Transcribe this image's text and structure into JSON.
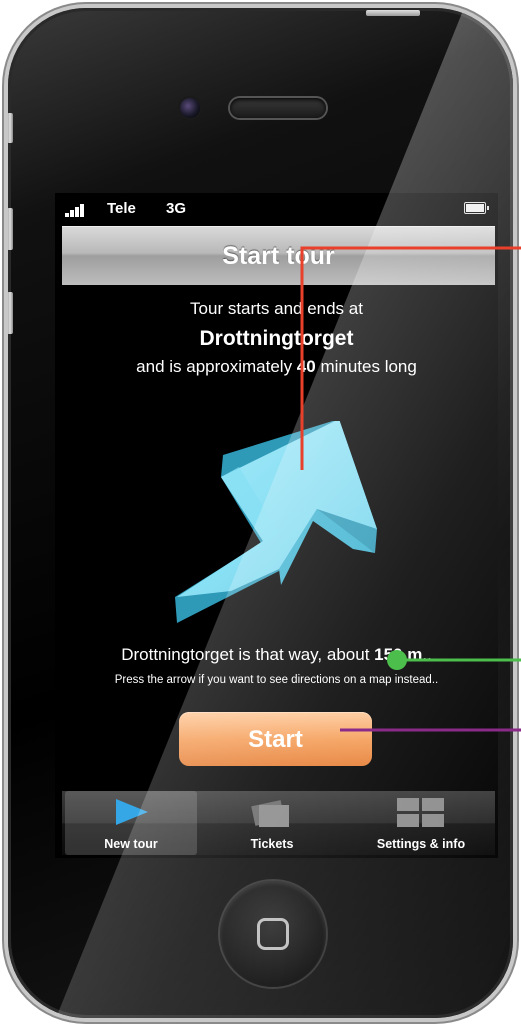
{
  "status_bar": {
    "carrier": "Tele",
    "network": "3G"
  },
  "nav": {
    "title": "Start tour"
  },
  "intro": {
    "line1": "Tour starts and ends at",
    "location": "Drottningtorget",
    "duration_prefix": "and is approximately ",
    "duration_value": "40",
    "duration_suffix": " minutes long"
  },
  "direction": {
    "prefix": "Drottningtorget is that way, about ",
    "distance": "150 m",
    "suffix": "..",
    "hint": "Press the arrow if you want to see directions on a map instead.."
  },
  "start_button": {
    "label": "Start"
  },
  "tabs": [
    {
      "label": "New tour",
      "icon": "play-icon",
      "active": true
    },
    {
      "label": "Tickets",
      "icon": "tickets-icon",
      "active": false
    },
    {
      "label": "Settings & info",
      "icon": "settings-grid-icon",
      "active": false
    }
  ],
  "colors": {
    "arrow": "#6fd3ec",
    "start_button": "#f59e58",
    "annotation_red": "#e8402a",
    "annotation_green": "#4cbe4c",
    "annotation_purple": "#8a2b8a"
  }
}
